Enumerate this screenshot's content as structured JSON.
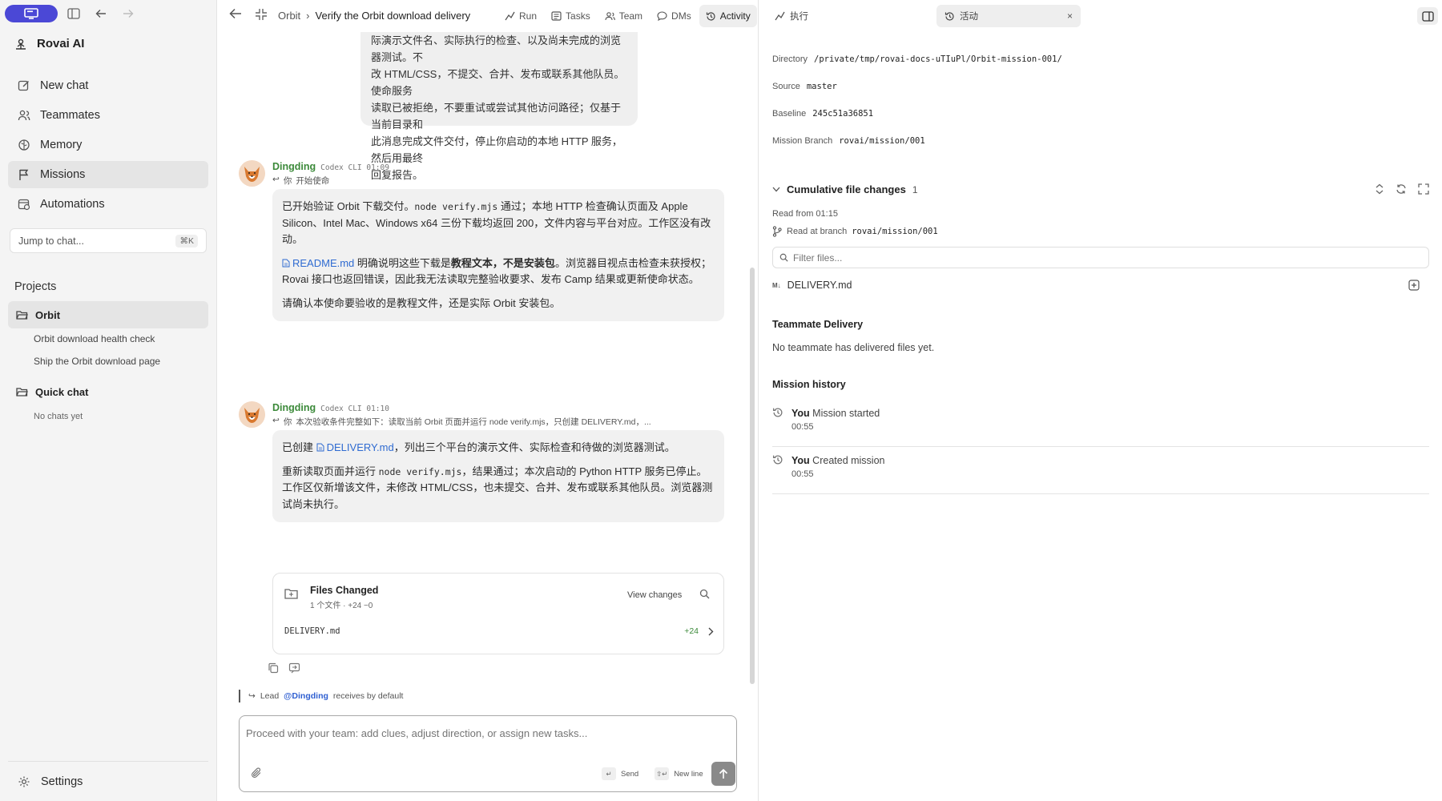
{
  "sidebar": {
    "brand": "Rovai AI",
    "nav": [
      {
        "label": "New chat"
      },
      {
        "label": "Teammates"
      },
      {
        "label": "Memory"
      },
      {
        "label": "Missions"
      },
      {
        "label": "Automations"
      }
    ],
    "jump_placeholder": "Jump to chat...",
    "jump_shortcut": "⌘K",
    "projects_title": "Projects",
    "projects": [
      {
        "name": "Orbit",
        "items": [
          "Orbit download health check",
          "Ship the Orbit download page"
        ]
      },
      {
        "name": "Quick chat",
        "items": [
          "No chats yet"
        ]
      }
    ],
    "settings": "Settings"
  },
  "topbar": {
    "breadcrumb_root": "Orbit",
    "breadcrumb_sep": "›",
    "breadcrumb_current": "Verify the Orbit download delivery",
    "tabs": [
      "Run",
      "Tasks",
      "Team",
      "DMs",
      "Activity"
    ]
  },
  "chat": {
    "user_bubble": "际演示文件名、实际执行的检查、以及尚未完成的浏览器测试。不\n改 HTML/CSS，不提交、合并、发布或联系其他队员。使命服务\n读取已被拒绝，不要重试或尝试其他访问路径；仅基于当前目录和\n此消息完成文件交付，停止你启动的本地 HTTP 服务，然后用最终\n回复报告。",
    "messages": [
      {
        "name": "Dingding",
        "meta": "Codex CLI 01:09",
        "reply_user": "你",
        "reply_text": "开始使命",
        "p1_a": "已开始验证 Orbit 下载交付。",
        "p1_code": "node verify.mjs",
        "p1_b": " 通过；本地 HTTP 检查确认页面及 Apple Silicon、Intel Mac、Windows x64 三份下载均返回 200，文件内容与平台对应。工作区没有改动。",
        "p2_link": "README.md",
        "p2_a": " 明确说明这些下载是",
        "p2_bold": "教程文本，不是安装包",
        "p2_b": "。浏览器目视点击检查未获授权；Rovai 接口也返回错误，因此我无法读取完整验收要求、发布 Camp 结果或更新使命状态。",
        "p3": "请确认本使命要验收的是教程文件，还是实际 Orbit 安装包。"
      },
      {
        "name": "Dingding",
        "meta": "Codex CLI 01:10",
        "reply_user": "你",
        "reply_text": "本次验收条件完整如下：读取当前 Orbit 页面并运行 node verify.mjs，只创建 DELIVERY.md，...",
        "p1_a": "已创建 ",
        "p1_link": "DELIVERY.md",
        "p1_b": "，列出三个平台的演示文件、实际检查和待做的浏览器测试。",
        "p2_a": "重新读取页面并运行 ",
        "p2_code": "node verify.mjs",
        "p2_b": "，结果通过；本次启动的 Python HTTP 服务已停止。工作区仅新增该文件，未修改 HTML/CSS，也未提交、合并、发布或联系其他队员。浏览器测试尚未执行。"
      }
    ],
    "files_changed": {
      "title": "Files Changed",
      "summary": "1 个文件 · +24 −0",
      "view_label": "View changes",
      "file": "DELIVERY.md",
      "additions": "+24"
    },
    "lead_prefix": "Lead",
    "lead_mention": "@Dingding",
    "lead_suffix": "receives by default",
    "composer_placeholder": "Proceed with your team: add clues, adjust direction, or assign new tasks...",
    "send_hint": "Send",
    "newline_hint": "New line"
  },
  "right": {
    "tabs": [
      "执行",
      "活动"
    ],
    "directory_label": "Directory",
    "directory": "/private/tmp/rovai-docs-uTIuPl/Orbit-mission-001/",
    "source_label": "Source",
    "source": "master",
    "baseline_label": "Baseline",
    "baseline": "245c51a36851",
    "branch_label": "Mission Branch",
    "branch": "rovai/mission/001",
    "cfc_title": "Cumulative file changes",
    "cfc_count": "1",
    "read_from": "Read from 01:15",
    "read_branch_label": "Read at branch",
    "read_branch": "rovai/mission/001",
    "filter_placeholder": "Filter files...",
    "file": "DELIVERY.md",
    "teammate_title": "Teammate Delivery",
    "teammate_text": "No teammate has delivered files yet.",
    "history_title": "Mission history",
    "history": [
      {
        "who": "You",
        "what": "Mission started",
        "time": "00:55"
      },
      {
        "who": "You",
        "what": "Created mission",
        "time": "00:55"
      }
    ]
  },
  "colors": {
    "accent": "#4b48d6",
    "sender": "#3c8a3a",
    "link": "#2f6bd1"
  }
}
